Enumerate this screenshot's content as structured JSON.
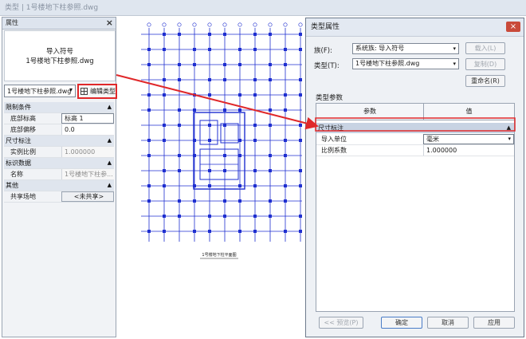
{
  "window_title": "类型 | 1号楼地下柱参照.dwg",
  "properties_panel": {
    "title": "属性",
    "close_glyph": "×",
    "preview_line1": "导入符号",
    "preview_line2": "1号楼地下柱参照.dwg",
    "type_selector": "1号楼地下柱参照.dwg",
    "edit_type_label": "编辑类型",
    "groups": [
      {
        "title": "限制条件",
        "rows": [
          {
            "key": "底部标高",
            "value": "标高 1"
          },
          {
            "key": "底部偏移",
            "value": "0.0"
          }
        ]
      },
      {
        "title": "尺寸标注",
        "rows": [
          {
            "key": "实例比例",
            "value": "1.000000"
          }
        ]
      },
      {
        "title": "标识数据",
        "rows": [
          {
            "key": "名称",
            "value": "1号楼地下柱参..."
          }
        ]
      },
      {
        "title": "其他",
        "rows": [
          {
            "key": "共享场地",
            "value": "<未共享>"
          }
        ]
      }
    ]
  },
  "dialog": {
    "title": "类型属性",
    "close_glyph": "×",
    "family_label": "族(F):",
    "family_value": "系统族: 导入符号",
    "type_label": "类型(T):",
    "type_value": "1号楼地下柱参照.dwg",
    "load_button": "载入(L)",
    "duplicate_button": "复制(D)",
    "rename_button": "重命名(R)",
    "type_params_label": "类型参数",
    "col_param": "参数",
    "col_value": "值",
    "group_title": "尺寸标注",
    "rows": [
      {
        "key": "导入单位",
        "value": "毫米"
      },
      {
        "key": "比例系数",
        "value": "1.000000"
      }
    ],
    "preview_button": "<< 预览(P)",
    "ok_button": "确定",
    "cancel_button": "取消",
    "apply_button": "应用"
  },
  "drawing": {
    "caption": "1号楼地下柱平面图"
  },
  "colors": {
    "annotation_red": "#e0282a",
    "grid_blue": "#1f2fd0"
  }
}
